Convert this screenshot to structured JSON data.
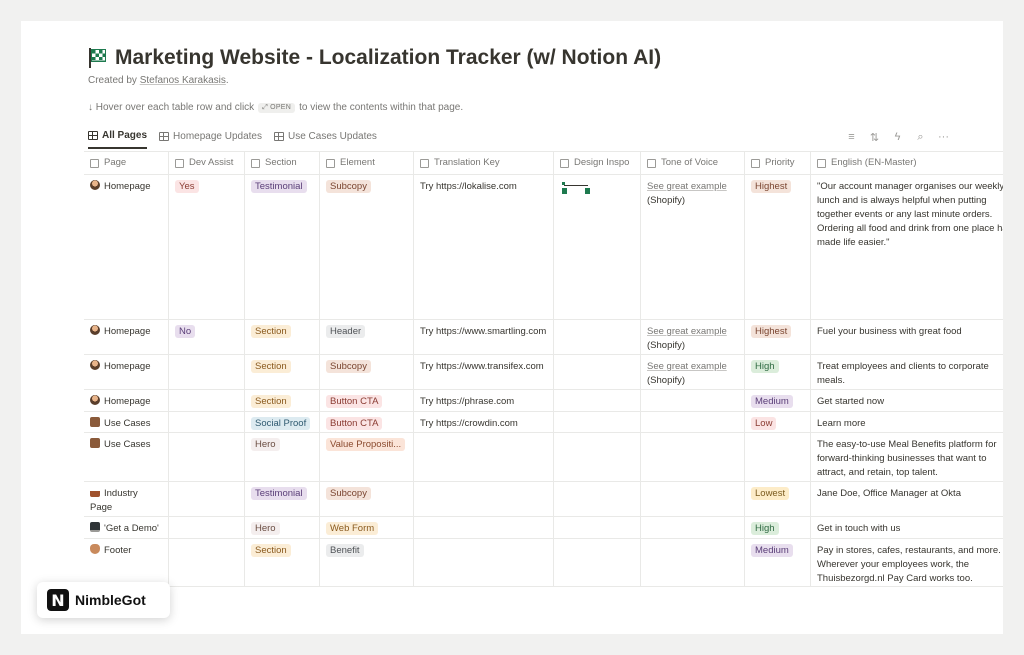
{
  "page": {
    "title": "Marketing Website - Localization Tracker (w/ Notion AI)",
    "created_prefix": "Created by ",
    "author": "Stefanos Karakasis",
    "created_suffix": ".",
    "hint_before": "↓ Hover over each table row and click",
    "hint_chip": "OPEN",
    "hint_after": "to view the contents within that page."
  },
  "tabs": [
    {
      "label": "All Pages",
      "active": true
    },
    {
      "label": "Homepage Updates",
      "active": false
    },
    {
      "label": "Use Cases Updates",
      "active": false
    }
  ],
  "toolbar": {
    "filter": "≡",
    "sort": "⇅",
    "automation": "ϟ",
    "search": "⌕",
    "more": "···"
  },
  "columns": [
    "Page",
    "Dev Assist",
    "Section",
    "Element",
    "Translation Key",
    "Design Inspo",
    "Tone of Voice",
    "Priority",
    "English (EN-Master)"
  ],
  "tag_colors": {
    "Yes": {
      "bg": "#fbe4e4",
      "fg": "#8a3b32"
    },
    "No": {
      "bg": "#e8deee",
      "fg": "#5a3e78"
    },
    "Testimonial": {
      "bg": "#e8deee",
      "fg": "#5a3e78"
    },
    "Section": {
      "bg": "#fbedd6",
      "fg": "#8a5a1e"
    },
    "Social Proof": {
      "bg": "#ddebf1",
      "fg": "#2f5a70"
    },
    "Hero": {
      "bg": "#f4eeee",
      "fg": "#6a4d42"
    },
    "Subcopy": {
      "bg": "#f4e3da",
      "fg": "#7a4530"
    },
    "Header": {
      "bg": "#ebeced",
      "fg": "#505357"
    },
    "Button CTA": {
      "bg": "#fbe4e4",
      "fg": "#8a3b32"
    },
    "Value Propositi...": {
      "bg": "#fbe4d8",
      "fg": "#8a4a2e"
    },
    "Web Form": {
      "bg": "#fbedd6",
      "fg": "#8a5a1e"
    },
    "Benefit": {
      "bg": "#ebeced",
      "fg": "#505357"
    },
    "Highest": {
      "bg": "#f4e3da",
      "fg": "#7a4530"
    },
    "High": {
      "bg": "#dbeddb",
      "fg": "#2f6a42"
    },
    "Medium": {
      "bg": "#e8deee",
      "fg": "#5a3e78"
    },
    "Low": {
      "bg": "#fbe4e4",
      "fg": "#8a3b32"
    },
    "Lowest": {
      "bg": "#fdecc8",
      "fg": "#7a5a1e"
    }
  },
  "rows": [
    {
      "page": "Homepage",
      "emoji": "person",
      "dev": "Yes",
      "section": "Testimonial",
      "element": "Subcopy",
      "key": "Try https://lokalise.com",
      "design": true,
      "tone_link": "See great example",
      "tone_text": "(Shopify)",
      "priority": "Highest",
      "english": "\"Our account manager organises our weekly lunch and is always helpful when putting together events or any last minute orders. Ordering all food and drink from one place has made life easier.\"",
      "height": 145
    },
    {
      "page": "Homepage",
      "emoji": "person",
      "dev": "No",
      "section": "Section",
      "element": "Header",
      "key": "Try https://www.smartling.com",
      "design": false,
      "tone_link": "See great example",
      "tone_text": "(Shopify)",
      "priority": "Highest",
      "english": "Fuel your business with great food",
      "height": 35
    },
    {
      "page": "Homepage",
      "emoji": "person",
      "dev": "",
      "section": "Section",
      "element": "Subcopy",
      "key": "Try https://www.transifex.com",
      "design": false,
      "tone_link": "See great example",
      "tone_text": "(Shopify)",
      "priority": "High",
      "english": "Treat employees and clients to corporate meals.",
      "height": 35
    },
    {
      "page": "Homepage",
      "emoji": "person",
      "dev": "",
      "section": "Section",
      "element": "Button CTA",
      "key": "Try https://phrase.com",
      "design": false,
      "tone_link": "",
      "tone_text": "",
      "priority": "Medium",
      "english": "Get started now",
      "height": 22
    },
    {
      "page": "Use Cases",
      "emoji": "bag",
      "dev": "",
      "section": "Social Proof",
      "element": "Button CTA",
      "key": "Try https://crowdin.com",
      "design": false,
      "tone_link": "",
      "tone_text": "",
      "priority": "Low",
      "english": "Learn more",
      "height": 21
    },
    {
      "page": "Use Cases",
      "emoji": "bag",
      "dev": "",
      "section": "Hero",
      "element": "Value Propositi...",
      "key": "",
      "design": false,
      "tone_link": "",
      "tone_text": "",
      "priority": "",
      "english": "The easy-to-use Meal Benefits platform for forward-thinking businesses that want to attract, and retain, top talent.",
      "height": 49
    },
    {
      "page": "Industry Page",
      "emoji": "factory",
      "dev": "",
      "section": "Testimonial",
      "element": "Subcopy",
      "key": "",
      "design": false,
      "tone_link": "",
      "tone_text": "",
      "priority": "Lowest",
      "english": "Jane Doe, Office Manager at Okta",
      "height": 35
    },
    {
      "page": "'Get a Demo'",
      "emoji": "monitor",
      "dev": "",
      "section": "Hero",
      "element": "Web Form",
      "key": "",
      "design": false,
      "tone_link": "",
      "tone_text": "",
      "priority": "High",
      "english": "Get in touch with us",
      "height": 22
    },
    {
      "page": "Footer",
      "emoji": "foot",
      "dev": "",
      "section": "Section",
      "element": "Benefit",
      "key": "",
      "design": false,
      "tone_link": "",
      "tone_text": "",
      "priority": "Medium",
      "english": "Pay in stores, cafes, restaurants, and more. Wherever your employees work, the Thuisbezorgd.nl Pay Card works too.",
      "height": 48
    }
  ],
  "brand": {
    "mark": "N",
    "name": "NimbleGot"
  }
}
